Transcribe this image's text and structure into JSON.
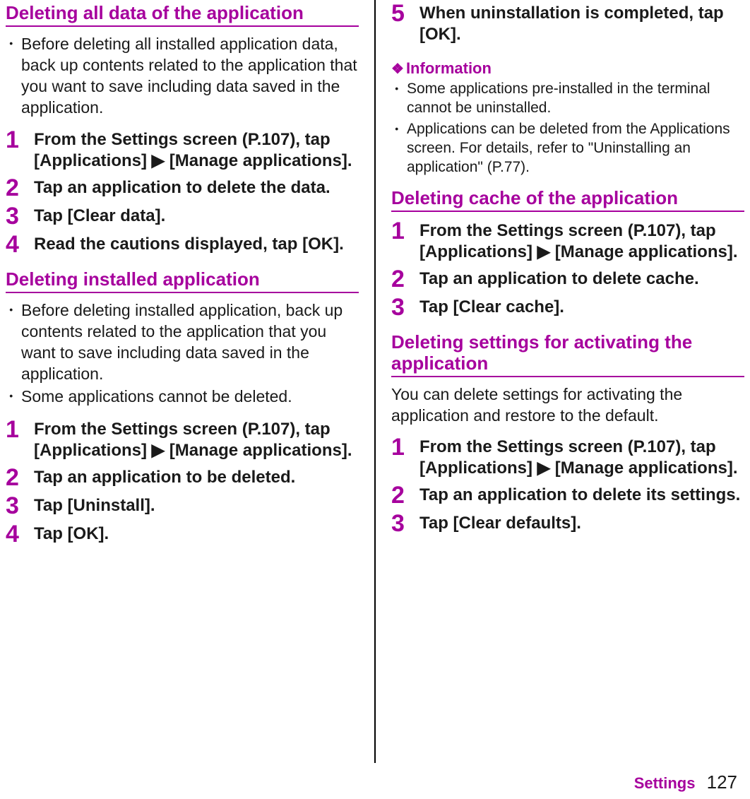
{
  "left": {
    "s1": {
      "title": "Deleting all data of the application",
      "bullets": [
        "Before deleting all installed application data, back up contents related to the application that you want to save including data saved in the application."
      ],
      "steps": [
        "From the Settings screen (P.107), tap [Applications] ▶ [Manage applications].",
        "Tap an application to delete the data.",
        "Tap [Clear data].",
        "Read the cautions displayed, tap [OK]."
      ]
    },
    "s2": {
      "title": "Deleting installed application",
      "bullets": [
        "Before deleting installed application, back up contents related to the application that you want to save including data saved in the application.",
        "Some applications cannot be deleted."
      ],
      "steps": [
        "From the Settings screen (P.107), tap [Applications] ▶ [Manage applications].",
        "Tap an application to be deleted.",
        "Tap [Uninstall].",
        "Tap [OK]."
      ]
    }
  },
  "right": {
    "contStep": {
      "num": "5",
      "text": "When uninstallation is completed, tap [OK]."
    },
    "info": {
      "head": "Information",
      "bullets": [
        "Some applications pre-installed in the terminal cannot be uninstalled.",
        "Applications can be deleted from the Applications screen. For details, refer to \"Uninstalling an application\" (P.77)."
      ]
    },
    "s3": {
      "title": "Deleting cache of the application",
      "steps": [
        "From the Settings screen (P.107), tap [Applications] ▶ [Manage applications].",
        "Tap an application to delete cache.",
        "Tap [Clear cache]."
      ]
    },
    "s4": {
      "title": "Deleting settings for activating the application",
      "intro": "You can delete settings for activating the application and restore to the default.",
      "steps": [
        "From the Settings screen (P.107), tap [Applications] ▶ [Manage applications].",
        "Tap an application to delete its settings.",
        "Tap [Clear defaults]."
      ]
    }
  },
  "footer": {
    "category": "Settings",
    "page": "127"
  }
}
